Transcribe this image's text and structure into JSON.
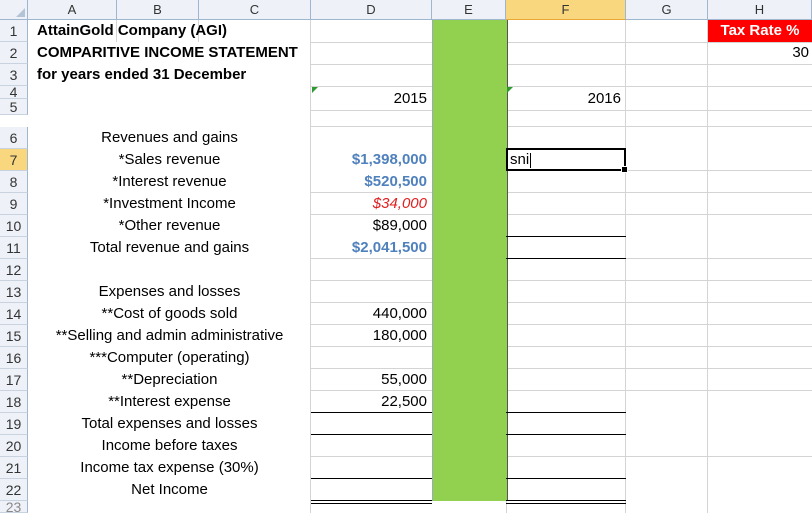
{
  "columns": [
    "A",
    "B",
    "C",
    "D",
    "E",
    "F",
    "G",
    "H"
  ],
  "rows": [
    "1",
    "2",
    "3",
    "4",
    "5",
    "6",
    "7",
    "8",
    "9",
    "10",
    "11",
    "12",
    "13",
    "14",
    "15",
    "16",
    "17",
    "18",
    "19",
    "20",
    "21",
    "22",
    "23"
  ],
  "header": {
    "company": "AttainGold Company (AGI)",
    "title": "COMPARITIVE INCOME STATEMENT",
    "period": "for years ended 31 December"
  },
  "tax": {
    "label": "Tax Rate %",
    "value": "30"
  },
  "years": {
    "y1": "2015",
    "y2": "2016"
  },
  "labels": {
    "r6": "Revenues and gains",
    "r7": "*Sales revenue",
    "r8": "*Interest revenue",
    "r9": "*Investment Income",
    "r10": "*Other revenue",
    "r11": "Total revenue and gains",
    "r13": "Expenses and losses",
    "r14": "**Cost of goods sold",
    "r15": "**Selling and admin administrative",
    "r16": "***Computer (operating)",
    "r17": "**Depreciation",
    "r18": "**Interest expense",
    "r19": "Total expenses and losses",
    "r20": "Income before taxes",
    "r21": "Income tax expense (30%)",
    "r22": "Net Income"
  },
  "values2015": {
    "r7": "$1,398,000",
    "r8": "$520,500",
    "r9": "$34,000",
    "r10": "$89,000",
    "r11": "$2,041,500",
    "r14": "440,000",
    "r15": "180,000",
    "r17": "55,000",
    "r18": "22,500"
  },
  "active_cell": {
    "value": "sni"
  },
  "colors": {
    "green_column": "#92d050",
    "tax_header": "#ff0000",
    "blue_values": "#4f81bd",
    "selected_header": "#f9d77e"
  }
}
